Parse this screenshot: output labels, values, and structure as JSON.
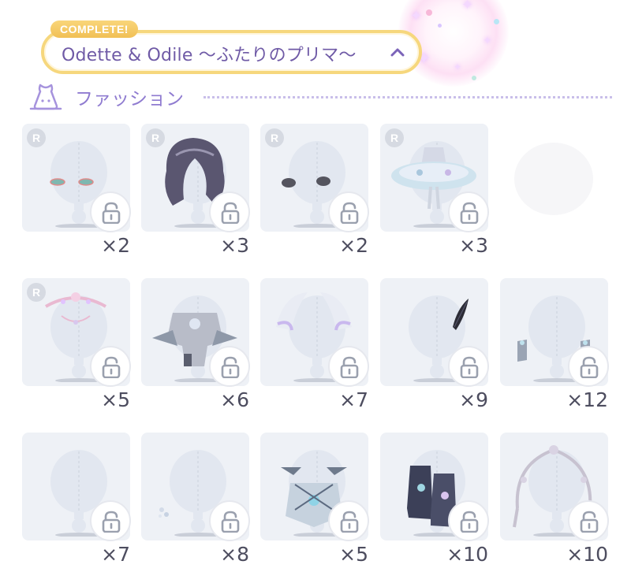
{
  "header": {
    "badge": "COMPLETE!",
    "title": "Odette & Odile ～ふたりのプリマ～",
    "chevron_icon": "chevron-up-icon"
  },
  "section": {
    "title": "ファッション",
    "icon": "dress-icon"
  },
  "colors": {
    "badge": "#f1c055",
    "header_border": "#f6d77d",
    "title_purple": "#6f5aa6",
    "section_purple": "#8f7bd0",
    "card_bg": "#eef1f6"
  },
  "items": [
    {
      "rarity": "R",
      "quantity": "×2",
      "kind": "eyes",
      "locked": true
    },
    {
      "rarity": "R",
      "quantity": "×3",
      "kind": "hair",
      "locked": true
    },
    {
      "rarity": "R",
      "quantity": "×2",
      "kind": "eyebrows",
      "locked": true
    },
    {
      "rarity": "R",
      "quantity": "×3",
      "kind": "tutu-dress",
      "locked": true
    },
    {
      "rarity": "",
      "quantity": "",
      "kind": "faded-item",
      "locked": false
    },
    {
      "rarity": "R",
      "quantity": "×5",
      "kind": "tiara",
      "locked": true
    },
    {
      "rarity": "",
      "quantity": "×6",
      "kind": "outfit",
      "locked": true
    },
    {
      "rarity": "",
      "quantity": "×7",
      "kind": "feather-headpiece",
      "locked": true
    },
    {
      "rarity": "",
      "quantity": "×9",
      "kind": "black-feather",
      "locked": true
    },
    {
      "rarity": "",
      "quantity": "×12",
      "kind": "arm-cuffs",
      "locked": true
    },
    {
      "rarity": "",
      "quantity": "×7",
      "kind": "earring",
      "locked": true
    },
    {
      "rarity": "",
      "quantity": "×8",
      "kind": "small-accessory",
      "locked": true
    },
    {
      "rarity": "",
      "quantity": "×5",
      "kind": "ribbon-top",
      "locked": true
    },
    {
      "rarity": "",
      "quantity": "×10",
      "kind": "boots",
      "locked": true
    },
    {
      "rarity": "",
      "quantity": "×10",
      "kind": "ornate-frame",
      "locked": true
    }
  ]
}
